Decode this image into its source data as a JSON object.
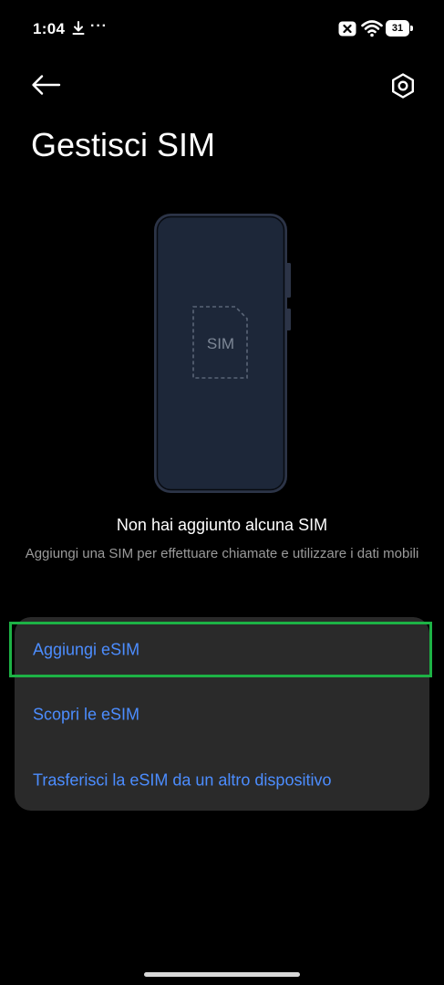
{
  "status_bar": {
    "time": "1:04",
    "more": "···",
    "battery_level": "31",
    "icons": [
      "download-icon",
      "overflow-dots-icon",
      "no-sim-icon",
      "wifi-icon",
      "battery-icon"
    ]
  },
  "app_bar": {
    "back_icon": "back-arrow-icon",
    "settings_icon": "settings-icon"
  },
  "page": {
    "title": "Gestisci SIM"
  },
  "illustration": {
    "sim_label": "SIM"
  },
  "empty_state": {
    "heading": "Non hai aggiunto alcuna SIM",
    "description": "Aggiungi una SIM per effettuare chiamate e utilizzare i dati mobili"
  },
  "options": [
    {
      "label": "Aggiungi eSIM"
    },
    {
      "label": "Scopri le eSIM"
    },
    {
      "label": "Trasferisci la eSIM da un altro dispositivo"
    }
  ],
  "colors": {
    "background": "#000000",
    "card": "#2a2a2a",
    "accent": "#4c8dff",
    "highlight": "#1db245",
    "secondary_text": "#9a9a9a"
  }
}
